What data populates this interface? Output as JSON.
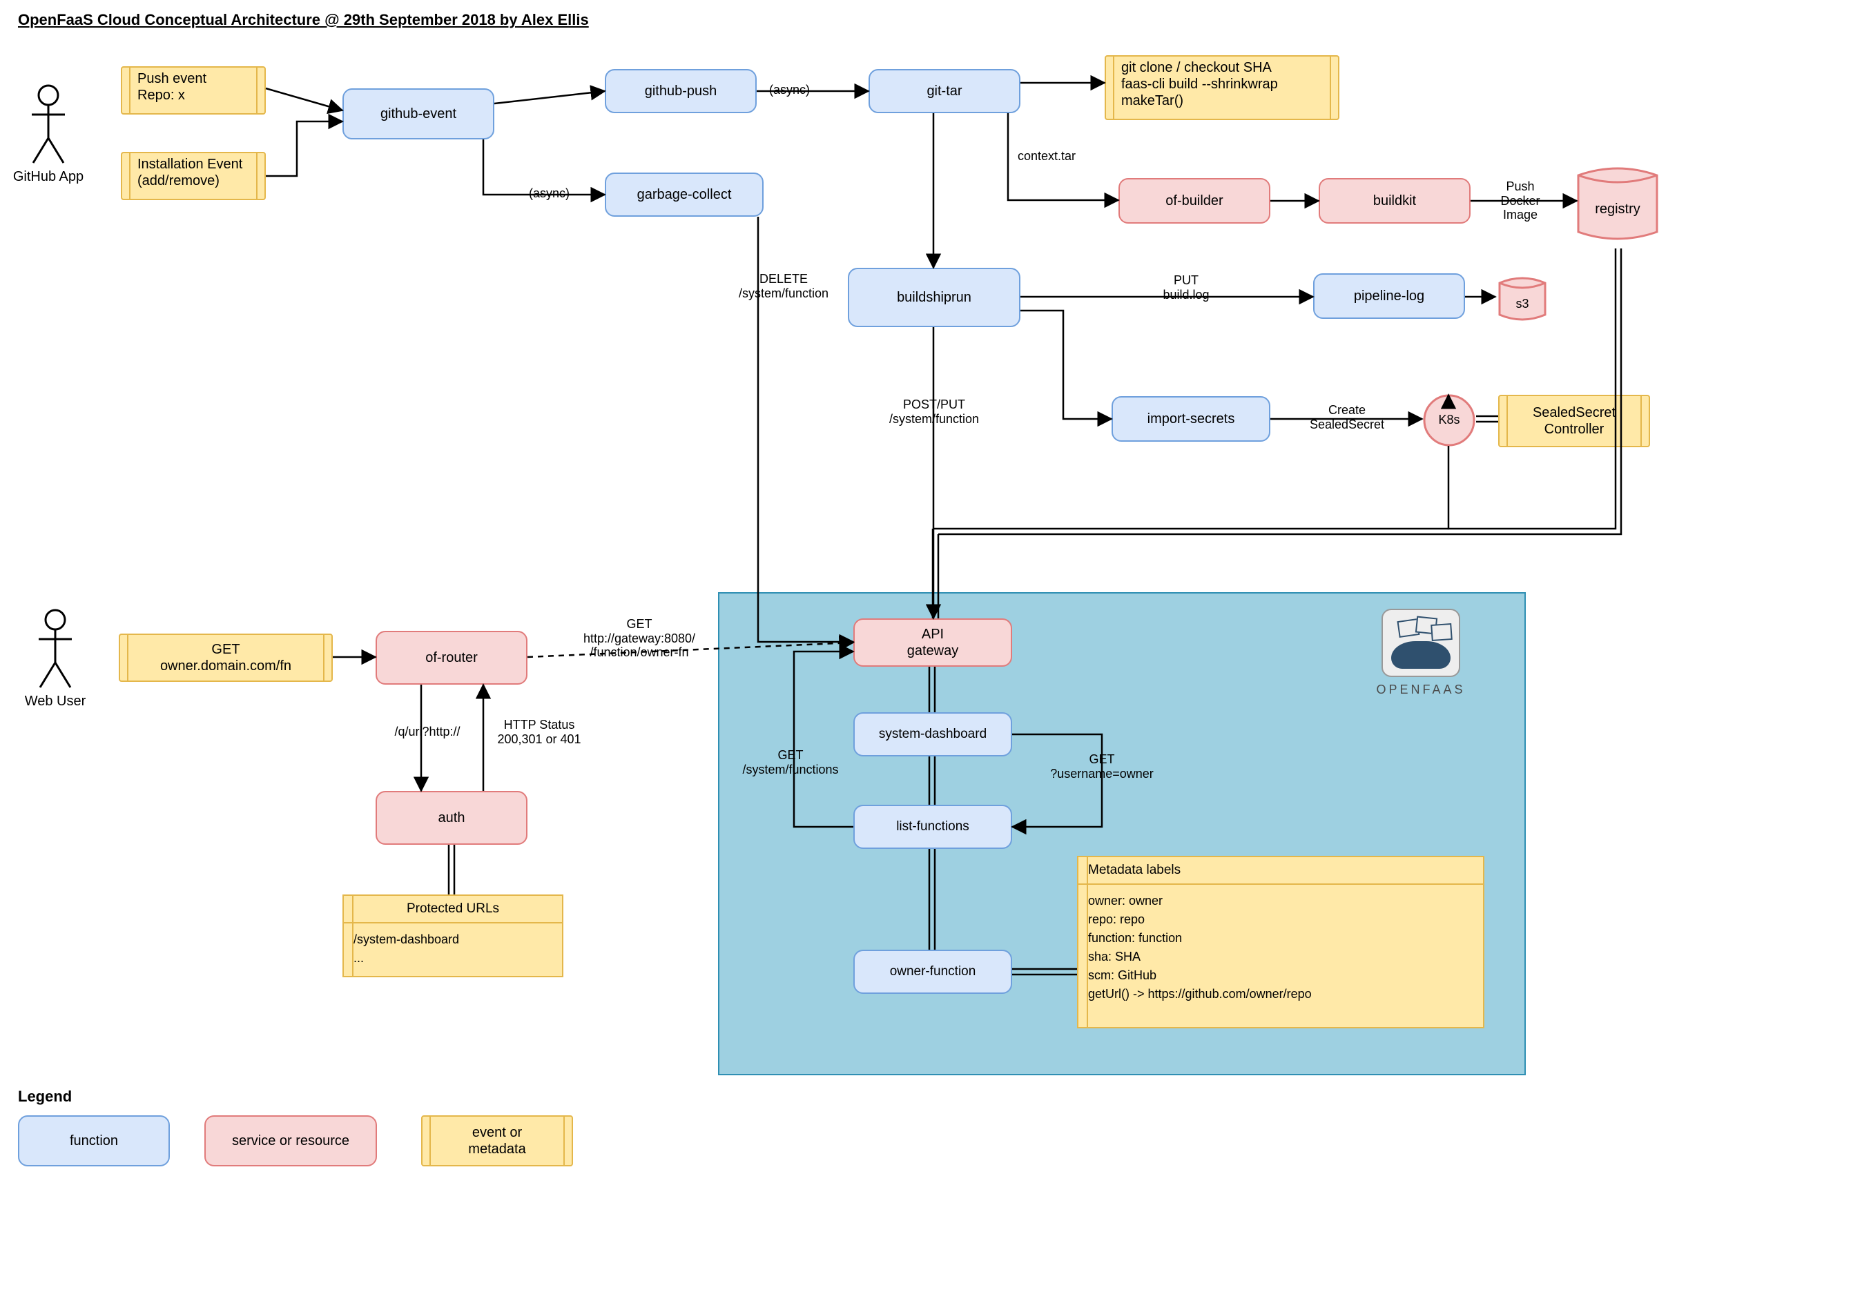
{
  "title": "OpenFaaS Cloud Conceptual Architecture @ 29th September 2018 by Alex Ellis",
  "actors": {
    "github_app": "GitHub App",
    "web_user": "Web User"
  },
  "events": {
    "push_event": "Push event\nRepo: x",
    "install_event": "Installation Event\n(add/remove)",
    "get_owner": "GET\nowner.domain.com/fn",
    "git_ops": "git clone / checkout SHA\nfaas-cli build --shrinkwrap\nmakeTar()",
    "sealed_controller": "SealedSecret\nController"
  },
  "functions": {
    "github_event": "github-event",
    "github_push": "github-push",
    "garbage_collect": "garbage-collect",
    "git_tar": "git-tar",
    "buildshiprun": "buildshiprun",
    "import_secrets": "import-secrets",
    "pipeline_log": "pipeline-log",
    "system_dashboard": "system-dashboard",
    "list_functions": "list-functions",
    "owner_function": "owner-function"
  },
  "services": {
    "of_builder": "of-builder",
    "buildkit": "buildkit",
    "registry": "registry",
    "s3": "s3",
    "k8s": "K8s",
    "of_router": "of-router",
    "auth": "auth",
    "api_gateway": "API\ngateway"
  },
  "edge_labels": {
    "async1": "(async)",
    "async2": "(async)",
    "context_tar": "context.tar",
    "push_docker": "Push\nDocker\nImage",
    "delete_fn": "DELETE\n/system/function",
    "put_buildlog": "PUT\nbuild.log",
    "create_sealed": "Create\nSealedSecret",
    "post_put_fn": "POST/PUT\n/system/function",
    "get_gateway": "GET\nhttp://gateway:8080/\n/function/owner-fn",
    "q_uri": "/q/uri?http://",
    "http_status": "HTTP Status\n200,301 or 401",
    "get_sys_fns": "GET\n/system/functions",
    "get_username": "GET\n?username=owner"
  },
  "protected_urls": {
    "header": "Protected URLs",
    "body": "/system-dashboard\n..."
  },
  "metadata": {
    "header": "Metadata labels",
    "body": "owner: owner\nrepo: repo\nfunction: function\nsha: SHA\nscm: GitHub\ngetUrl() -> https://github.com/owner/repo"
  },
  "brand": "OPENFAAS",
  "legend": {
    "title": "Legend",
    "function": "function",
    "service": "service or resource",
    "event": "event or\nmetadata"
  }
}
